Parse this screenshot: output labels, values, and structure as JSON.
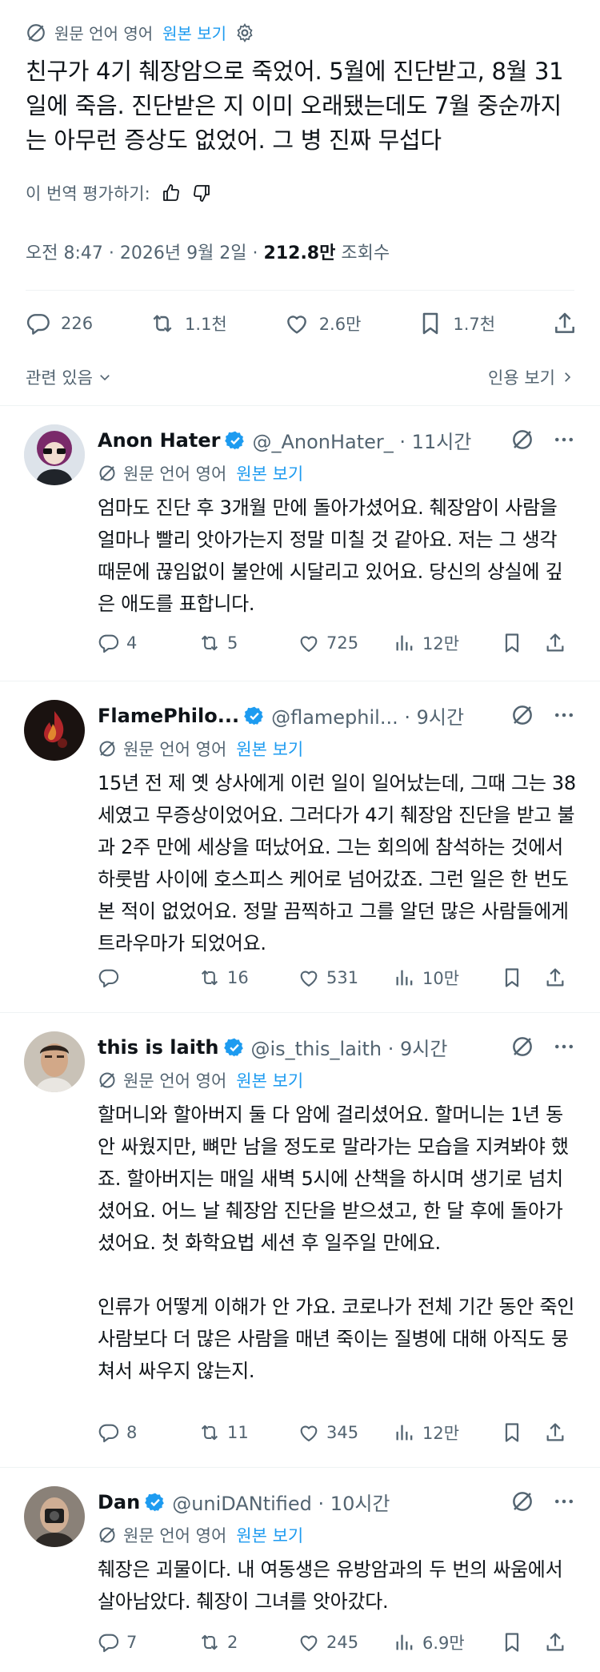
{
  "main_tweet": {
    "translation": {
      "source_label": "원문 언어 영어",
      "view_original": "원본 보기"
    },
    "text": "친구가 4기 췌장암으로 죽었어. 5월에 진단받고, 8월 31일에 죽음. 진단받은 지 이미 오래됐는데도 7월 중순까지는 아무런 증상도 없었어. 그 병 진짜 무섭다",
    "rate_label": "이 번역 평가하기:",
    "time": "오전 8:47 · 2026년 9월 2일 · ",
    "views_count": "212.8만",
    "views_label": " 조회수",
    "stats": {
      "replies": "226",
      "reposts": "1.1천",
      "likes": "2.6만",
      "bookmarks": "1.7천"
    },
    "related_label": "관련 있음",
    "quotes_label": "인용 보기"
  },
  "colors": {
    "accent": "#1d9bf0",
    "muted": "#536471",
    "divider": "#eff3f4"
  },
  "replies": [
    {
      "name": "Anon Hater",
      "handle": "@_AnonHater_ · 11시간",
      "translation": {
        "source_label": "원문 언어 영어",
        "view_original": "원본 보기"
      },
      "text": "엄마도 진단 후 3개월 만에 돌아가셨어요. 췌장암이 사람을 얼마나 빨리 앗아가는지 정말 미칠 것 같아요. 저는 그 생각 때문에 끊임없이 불안에 시달리고 있어요. 당신의 상실에 깊은 애도를 표합니다.",
      "replies": "4",
      "reposts": "5",
      "likes": "725",
      "views": "12만"
    },
    {
      "name": "FlamePhilo...",
      "handle": "@flamephil... · 9시간",
      "translation": {
        "source_label": "원문 언어 영어",
        "view_original": "원본 보기"
      },
      "text": "15년 전 제 옛 상사에게 이런 일이 일어났는데, 그때 그는 38세였고 무증상이었어요. 그러다가 4기 췌장암 진단을 받고 불과 2주 만에 세상을 떠났어요. 그는 회의에 참석하는 것에서 하룻밤 사이에 호스피스 케어로 넘어갔죠. 그런 일은 한 번도 본 적이 없었어요. 정말 끔찍하고 그를 알던 많은 사람들에게 트라우마가 되었어요.",
      "replies": "",
      "reposts": "16",
      "likes": "531",
      "views": "10만"
    },
    {
      "name": "this is laith",
      "handle": "@is_this_laith · 9시간",
      "translation": {
        "source_label": "원문 언어 영어",
        "view_original": "원본 보기"
      },
      "text": "할머니와 할아버지 둘 다 암에 걸리셨어요. 할머니는 1년 동안 싸웠지만, 뼈만 남을 정도로 말라가는 모습을 지켜봐야 했죠. 할아버지는 매일 새벽 5시에 산책을 하시며 생기로 넘치셨어요. 어느 날 췌장암 진단을 받으셨고, 한 달 후에 돌아가셨어요. 첫 화학요법 세션 후 일주일 만에요.\n\n인류가 어떻게 이해가 안 가요. 코로나가 전체 기간 동안 죽인 사람보다 더 많은 사람을 매년 죽이는 질병에 대해 아직도 뭉쳐서 싸우지 않는지.",
      "replies": "8",
      "reposts": "11",
      "likes": "345",
      "views": "12만"
    },
    {
      "name": "Dan",
      "handle": "@uniDANtified · 10시간",
      "translation": {
        "source_label": "원문 언어 영어",
        "view_original": "원본 보기"
      },
      "text": "췌장은 괴물이다. 내 여동생은 유방암과의 두 번의 싸움에서 살아남았다. 췌장이 그녀를 앗아갔다.",
      "replies": "7",
      "reposts": "2",
      "likes": "245",
      "views": "6.9만"
    }
  ]
}
